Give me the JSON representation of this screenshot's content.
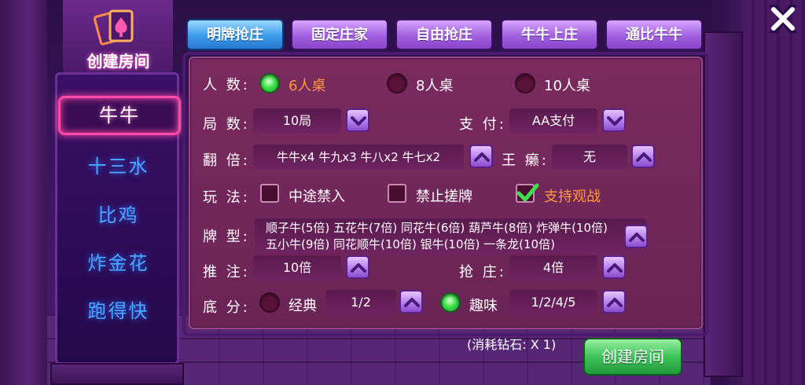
{
  "nav": {
    "title": "创建房间",
    "items": [
      "牛牛",
      "十三水",
      "比鸡",
      "炸金花",
      "跑得快"
    ]
  },
  "tabs": [
    "明牌抢庄",
    "固定庄家",
    "自由抢庄",
    "牛牛上庄",
    "通比牛牛"
  ],
  "form": {
    "players": {
      "label": "人 数:",
      "options": [
        "6人桌",
        "8人桌",
        "10人桌"
      ],
      "selected": "6人桌"
    },
    "rounds": {
      "label": "局 数:",
      "value": "10局"
    },
    "pay": {
      "label": "支 付:",
      "value": "AA支付"
    },
    "multiplier": {
      "label": "翻 倍:",
      "value": "牛牛x4 牛九x3 牛八x2 牛七x2"
    },
    "wild": {
      "label": "王 癞:",
      "value": "无"
    },
    "play": {
      "label": "玩 法:",
      "options": [
        {
          "text": "中途禁入",
          "checked": false
        },
        {
          "text": "禁止搓牌",
          "checked": false
        },
        {
          "text": "支持观战",
          "checked": true
        }
      ]
    },
    "card_type": {
      "label": "牌 型:",
      "line1": "顺子牛(5倍) 五花牛(7倍) 同花牛(6倍) 葫芦牛(8倍) 炸弹牛(10倍)",
      "line2": "五小牛(9倍) 同花顺牛(10倍) 银牛(10倍) 一条龙(10倍)"
    },
    "bet": {
      "label": "推 注:",
      "value": "10倍"
    },
    "grab": {
      "label": "抢 庄:",
      "value": "4倍"
    },
    "base": {
      "label": "底 分:",
      "classic": {
        "text": "经典",
        "value": "1/2",
        "selected": false
      },
      "fun": {
        "text": "趣味",
        "value": "1/2/4/5",
        "selected": true
      }
    }
  },
  "footer": {
    "cost": "(消耗钻石: X 1)",
    "create_label": "创建房间"
  },
  "colors": {
    "selected_text": "#ff9a3a",
    "nav_text": "#4aa8ff",
    "active_border": "#ff4aa8",
    "create_green": "#3ec25a"
  }
}
